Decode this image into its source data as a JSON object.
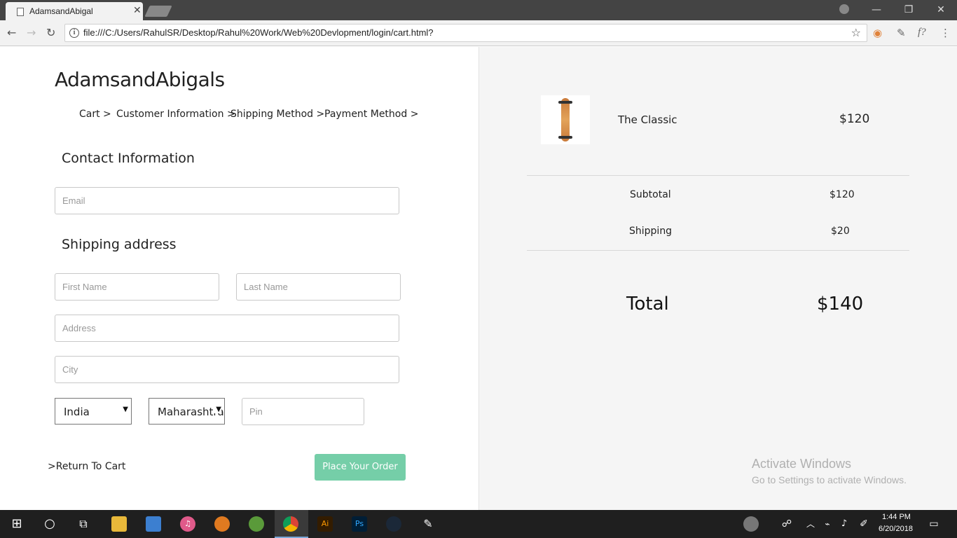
{
  "browser": {
    "tab_title": "AdamsandAbigal",
    "url": "file:///C:/Users/RahulSR/Desktop/Rahul%20Work/Web%20Devlopment/login/cart.html?"
  },
  "checkout": {
    "store_title": "AdamsandAbigals",
    "breadcrumb": [
      "Cart >",
      "Customer Information >",
      "Shipping Method >",
      "Payment Method >"
    ],
    "contact_title": "Contact Information",
    "email_placeholder": "Email",
    "shipping_title": "Shipping address",
    "first_name_placeholder": "First Name",
    "last_name_placeholder": "Last Name",
    "address_placeholder": "Address",
    "city_placeholder": "City",
    "country_value": "India",
    "state_value": "Maharashtra",
    "pin_placeholder": "Pin",
    "return_link": ">Return To Cart",
    "place_order": "Place Your Order"
  },
  "order": {
    "product_name": "The Classic",
    "product_price": "$120",
    "subtotal_label": "Subtotal",
    "subtotal_value": "$120",
    "shipping_label": "Shipping",
    "shipping_value": "$20",
    "total_label": "Total",
    "total_value": "$140"
  },
  "watermark": {
    "title": "Activate Windows",
    "subtitle": "Go to Settings to activate Windows."
  },
  "taskbar": {
    "time": "1:44 PM",
    "date": "6/20/2018"
  },
  "colors": {
    "accent_button": "#75cea8",
    "summary_background": "#f5f5f5"
  }
}
